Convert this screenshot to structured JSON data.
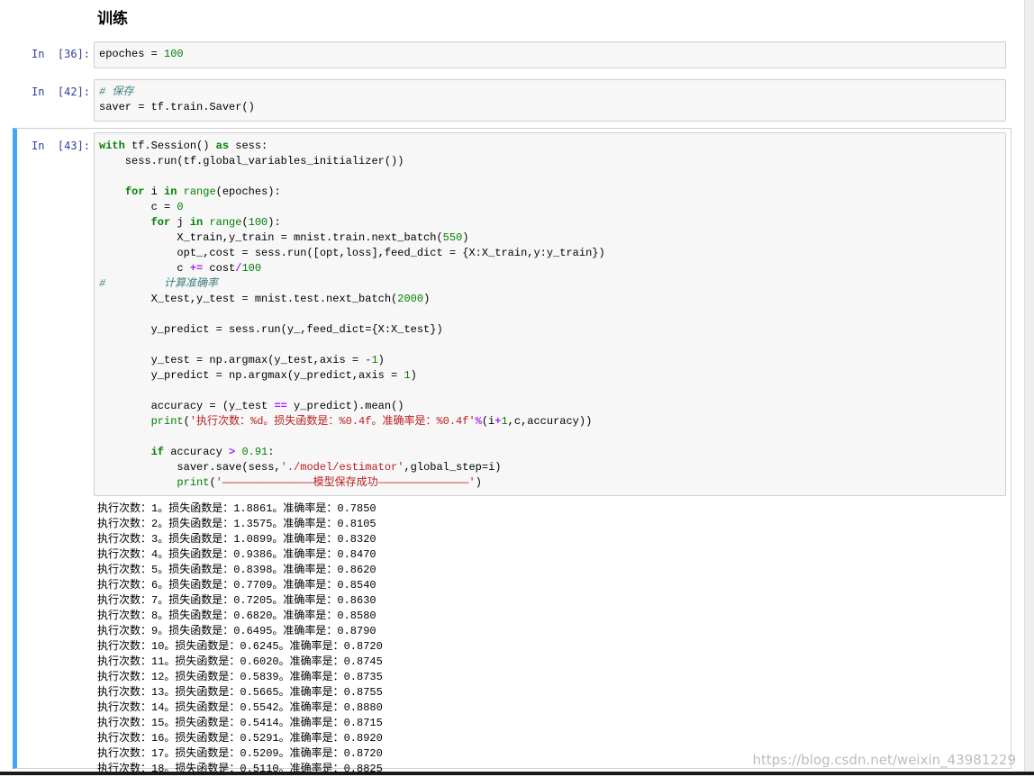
{
  "heading": "训练",
  "cells": [
    {
      "prompt": "In  [36]:",
      "lines": [
        "epoches = 100"
      ]
    },
    {
      "prompt": "In  [42]:",
      "lines": [
        "# 保存",
        "saver = tf.train.Saver()"
      ]
    },
    {
      "prompt": "In  [43]:",
      "lines": [
        "with tf.Session() as sess:",
        "    sess.run(tf.global_variables_initializer())",
        "",
        "    for i in range(epoches):",
        "        c = 0",
        "        for j in range(100):",
        "            X_train,y_train = mnist.train.next_batch(550)",
        "            opt_,cost = sess.run([opt,loss],feed_dict = {X:X_train,y:y_train})",
        "            c += cost/100",
        "#         计算准确率",
        "        X_test,y_test = mnist.test.next_batch(2000)",
        "",
        "        y_predict = sess.run(y_,feed_dict={X:X_test})",
        "",
        "        y_test = np.argmax(y_test,axis = -1)",
        "        y_predict = np.argmax(y_predict,axis = 1)",
        "",
        "        accuracy = (y_test == y_predict).mean()",
        "        print('执行次数：%d。损失函数是：%0.4f。准确率是：%0.4f'%(i+1,c,accuracy))",
        "",
        "        if accuracy > 0.91:",
        "            saver.save(sess,'./model/estimator',global_step=i)",
        "            print('——————————————模型保存成功——————————————')"
      ]
    }
  ],
  "output_lines": [
    "执行次数：1。损失函数是：1.8861。准确率是：0.7850",
    "执行次数：2。损失函数是：1.3575。准确率是：0.8105",
    "执行次数：3。损失函数是：1.0899。准确率是：0.8320",
    "执行次数：4。损失函数是：0.9386。准确率是：0.8470",
    "执行次数：5。损失函数是：0.8398。准确率是：0.8620",
    "执行次数：6。损失函数是：0.7709。准确率是：0.8540",
    "执行次数：7。损失函数是：0.7205。准确率是：0.8630",
    "执行次数：8。损失函数是：0.6820。准确率是：0.8580",
    "执行次数：9。损失函数是：0.6495。准确率是：0.8790",
    "执行次数：10。损失函数是：0.6245。准确率是：0.8720",
    "执行次数：11。损失函数是：0.6020。准确率是：0.8745",
    "执行次数：12。损失函数是：0.5839。准确率是：0.8735",
    "执行次数：13。损失函数是：0.5665。准确率是：0.8755",
    "执行次数：14。损失函数是：0.5542。准确率是：0.8880",
    "执行次数：15。损失函数是：0.5414。准确率是：0.8715",
    "执行次数：16。损失函数是：0.5291。准确率是：0.8920",
    "执行次数：17。损失函数是：0.5209。准确率是：0.8720",
    "执行次数：18。损失函数是：0.5110。准确率是：0.8825"
  ],
  "watermark": "https://blog.csdn.net/weixin_43981229",
  "colors": {
    "prompt": "#303f9f",
    "keyword": "#008000",
    "string": "#ba2121",
    "comment": "#408080",
    "operator": "#aa22ff",
    "selection_border": "#42a5f5"
  }
}
